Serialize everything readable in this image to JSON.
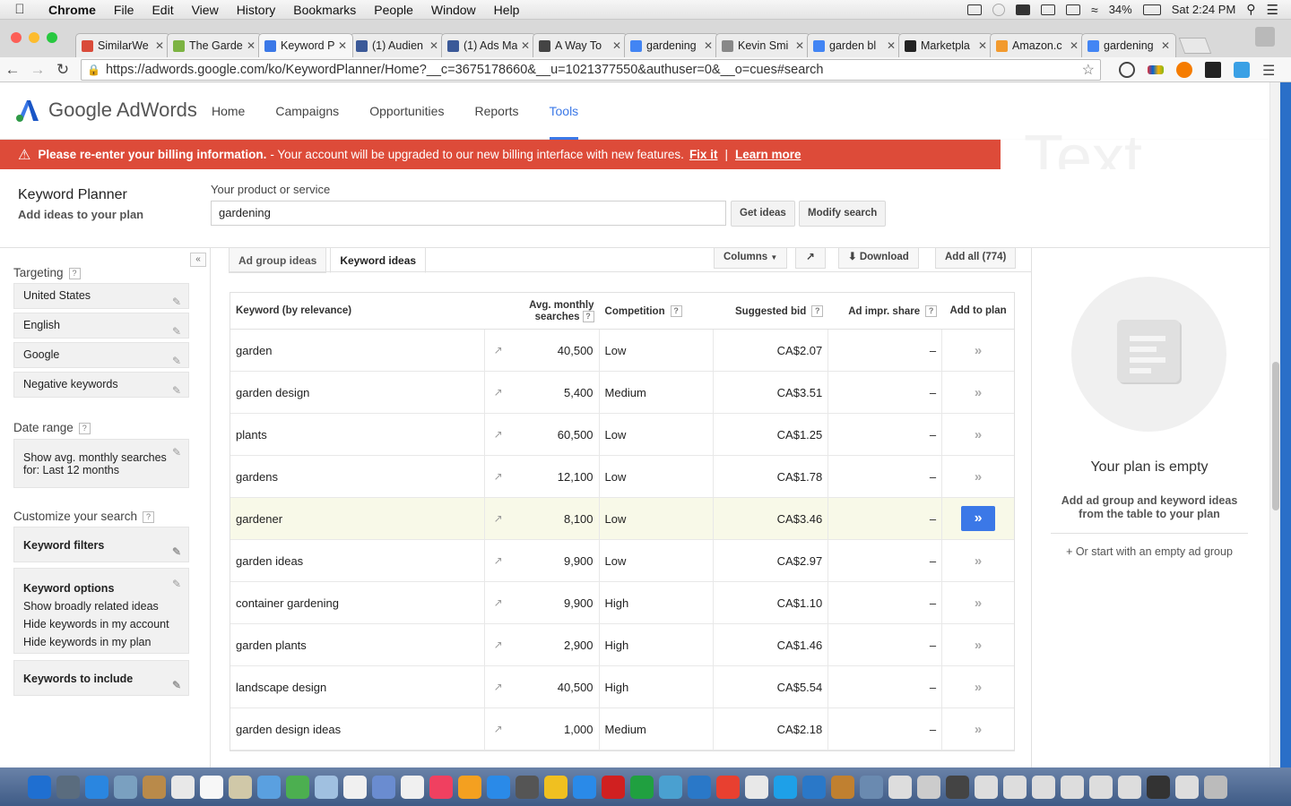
{
  "menubar": {
    "items": [
      "Chrome",
      "File",
      "Edit",
      "View",
      "History",
      "Bookmarks",
      "People",
      "Window",
      "Help"
    ],
    "battery": "34%",
    "clock": "Sat 2:24 PM"
  },
  "tabs": [
    {
      "title": "SimilarWe",
      "color": "#d94b3a"
    },
    {
      "title": "The Garde",
      "color": "#7cb342"
    },
    {
      "title": "Keyword P",
      "color": "#3b78e7",
      "active": true
    },
    {
      "title": "(1) Audien",
      "color": "#3b5998"
    },
    {
      "title": "(1) Ads Ma",
      "color": "#3b5998"
    },
    {
      "title": "A Way To",
      "color": "#444444"
    },
    {
      "title": "gardening",
      "color": "#4285f4"
    },
    {
      "title": "Kevin Smi",
      "color": "#888888"
    },
    {
      "title": "garden bl",
      "color": "#4285f4"
    },
    {
      "title": "Marketpla",
      "color": "#222222"
    },
    {
      "title": "Amazon.c",
      "color": "#f29a2e"
    },
    {
      "title": "gardening",
      "color": "#4285f4"
    }
  ],
  "address": {
    "url": "https://adwords.google.com/ko/KeywordPlanner/Home?__c=3675178660&__u=1021377550&authuser=0&__o=cues#search"
  },
  "adwords": {
    "brand": "Google AdWords",
    "nav": [
      "Home",
      "Campaigns",
      "Opportunities",
      "Reports",
      "Tools"
    ],
    "active_nav": "Tools"
  },
  "alert": {
    "bold": "Please re-enter your billing information.",
    "text": "- Your account will be upgraded to our new billing interface with new features.",
    "fix": "Fix it",
    "learn": "Learn more",
    "sep": "|"
  },
  "overlay_text": "Text",
  "planner": {
    "title": "Keyword Planner",
    "subtitle": "Add ideas to your plan",
    "product_label": "Your product or service",
    "product_value": "gardening",
    "get_ideas": "Get ideas",
    "modify_search": "Modify search"
  },
  "sidebar": {
    "targeting_title": "Targeting",
    "targeting": [
      "United States",
      "English",
      "Google",
      "Negative keywords"
    ],
    "date_title": "Date range",
    "date_line1": "Show avg. monthly searches",
    "date_line2": "for: Last 12 months",
    "customize_title": "Customize your search",
    "keyword_filters": "Keyword filters",
    "keyword_options": "Keyword options",
    "options": [
      "Show broadly related ideas",
      "Hide keywords in my account",
      "Hide keywords in my plan"
    ],
    "keywords_include": "Keywords to include"
  },
  "results": {
    "tabs": [
      "Ad group ideas",
      "Keyword ideas"
    ],
    "columns_btn": "Columns",
    "download_btn": "Download",
    "add_all_btn": "Add all (774)",
    "headers": {
      "keyword": "Keyword (by relevance)",
      "avg1": "Avg. monthly",
      "avg2": "searches",
      "competition": "Competition",
      "bid": "Suggested bid",
      "impr": "Ad impr. share",
      "add": "Add to plan"
    },
    "rows": [
      {
        "keyword": "garden",
        "avg": "40,500",
        "competition": "Low",
        "bid": "CA$2.07",
        "impr": "–"
      },
      {
        "keyword": "garden design",
        "avg": "5,400",
        "competition": "Medium",
        "bid": "CA$3.51",
        "impr": "–"
      },
      {
        "keyword": "plants",
        "avg": "60,500",
        "competition": "Low",
        "bid": "CA$1.25",
        "impr": "–"
      },
      {
        "keyword": "gardens",
        "avg": "12,100",
        "competition": "Low",
        "bid": "CA$1.78",
        "impr": "–"
      },
      {
        "keyword": "gardener",
        "avg": "8,100",
        "competition": "Low",
        "bid": "CA$3.46",
        "impr": "–"
      },
      {
        "keyword": "garden ideas",
        "avg": "9,900",
        "competition": "Low",
        "bid": "CA$2.97",
        "impr": "–"
      },
      {
        "keyword": "container gardening",
        "avg": "9,900",
        "competition": "High",
        "bid": "CA$1.10",
        "impr": "–"
      },
      {
        "keyword": "garden plants",
        "avg": "2,900",
        "competition": "High",
        "bid": "CA$1.46",
        "impr": "–"
      },
      {
        "keyword": "landscape design",
        "avg": "40,500",
        "competition": "High",
        "bid": "CA$5.54",
        "impr": "–"
      },
      {
        "keyword": "garden design ideas",
        "avg": "1,000",
        "competition": "Medium",
        "bid": "CA$2.18",
        "impr": "–"
      }
    ],
    "highlighted_row": 4
  },
  "plan": {
    "empty_title": "Your plan is empty",
    "empty_desc": "Add ad group and keyword ideas from the table to your plan",
    "start_link": "+ Or start with an empty ad group"
  },
  "colors": {
    "accent": "#3b78e7",
    "alert": "#dd4b39"
  }
}
